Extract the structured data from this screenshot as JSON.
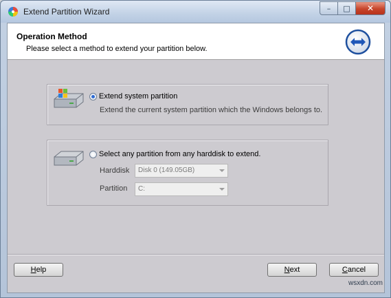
{
  "window": {
    "title": "Extend Partition Wizard",
    "controls": {
      "minimize": "–",
      "maximize": "□",
      "close": "✕"
    }
  },
  "header": {
    "title": "Operation Method",
    "subtitle": "Please select a method to extend your partition below.",
    "icon": "extend-arrows-icon"
  },
  "options": [
    {
      "label": "Extend system partition",
      "description": "Extend the current system partition which the Windows belongs to.",
      "selected": true,
      "icon": "system-disk-icon"
    },
    {
      "label": "Select any partition from any harddisk to extend.",
      "selected": false,
      "icon": "disk-icon",
      "fields": {
        "harddisk_label": "Harddisk",
        "harddisk_value": "Disk 0 (149.05GB)",
        "partition_label": "Partition",
        "partition_value": "C:"
      }
    }
  ],
  "buttons": {
    "help_key": "H",
    "help_rest": "elp",
    "next_key": "N",
    "next_rest": "ext",
    "cancel_key": "C",
    "cancel_rest": "ancel"
  },
  "watermark": "wsxdn.com"
}
